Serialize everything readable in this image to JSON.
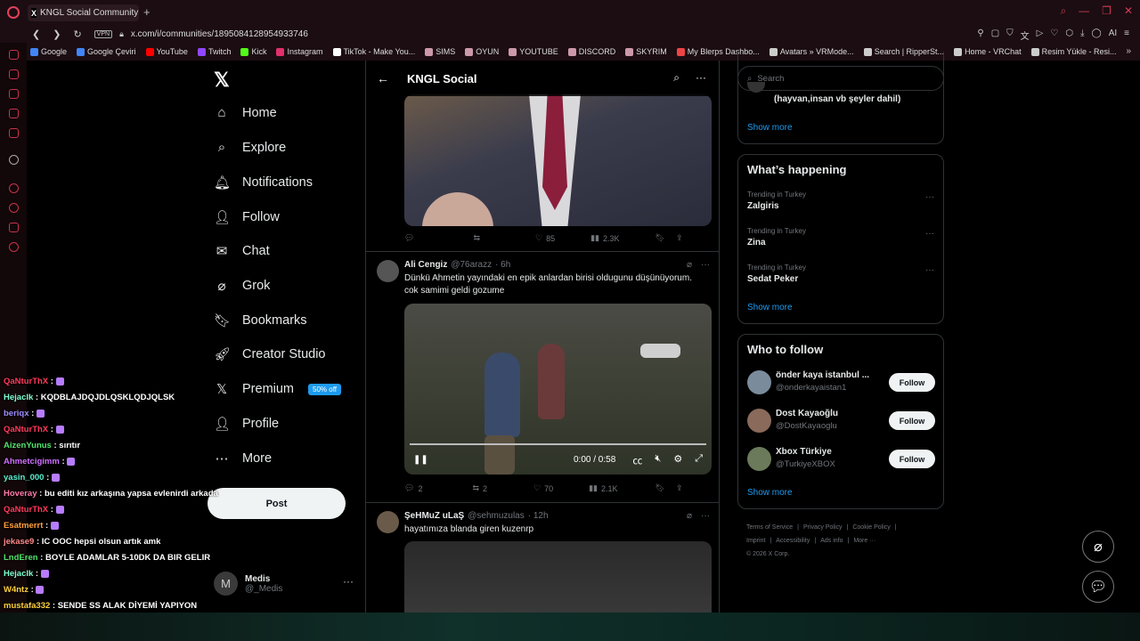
{
  "browser": {
    "tab_title": "KNGL Social Community /",
    "url": "x.com/i/communities/1895084128954933746",
    "vpn_label": "VPN",
    "bookmarks": [
      "Google",
      "Google Çeviri",
      "YouTube",
      "Twitch",
      "Kick",
      "Instagram",
      "TikTok - Make You...",
      "SIMS",
      "OYUN",
      "YOUTUBE",
      "DISCORD",
      "SKYRIM",
      "My Blerps Dashbo...",
      "Avatars » VRMode...",
      "Search | RipperSt...",
      "Home - VRChat",
      "Resim Yükle - Resi..."
    ],
    "bookmark_colors": [
      "#4285f4",
      "#4285f4",
      "#ff0000",
      "#9146ff",
      "#53fc18",
      "#e1306c",
      "#fff",
      "#c9a",
      "#c9a",
      "#c9a",
      "#c9a",
      "#c9a",
      "#e44",
      "#ccc",
      "#ccc",
      "#ccc",
      "#ccc"
    ],
    "ai_label": "AI"
  },
  "nav": {
    "items": [
      {
        "label": "Home",
        "icon": "home-icon",
        "glyph": "⌂"
      },
      {
        "label": "Explore",
        "icon": "search-icon",
        "glyph": "⌕"
      },
      {
        "label": "Notifications",
        "icon": "bell-icon",
        "glyph": "🔔︎"
      },
      {
        "label": "Follow",
        "icon": "person-add-icon",
        "glyph": "👤︎"
      },
      {
        "label": "Chat",
        "icon": "mail-icon",
        "glyph": "✉"
      },
      {
        "label": "Grok",
        "icon": "grok-icon",
        "glyph": "⌀"
      },
      {
        "label": "Bookmarks",
        "icon": "bookmark-icon",
        "glyph": "🔖︎"
      },
      {
        "label": "Creator Studio",
        "icon": "rocket-icon",
        "glyph": "🚀︎"
      },
      {
        "label": "Premium",
        "icon": "x-icon",
        "glyph": "𝕏"
      },
      {
        "label": "Profile",
        "icon": "profile-icon",
        "glyph": "👤︎"
      },
      {
        "label": "More",
        "icon": "more-circle-icon",
        "glyph": "⋯"
      }
    ],
    "premium_badge": "50% off",
    "post_label": "Post",
    "account": {
      "initial": "M",
      "name": "Medis",
      "handle": "@_Medis"
    }
  },
  "feed": {
    "title": "KNGL Social",
    "tweet1_actions": {
      "likes": "85",
      "views": "2.3K"
    },
    "tweet2": {
      "name": "Ali Cengiz",
      "handle": "@76arazz",
      "time": "· 6h",
      "text": "Dünkü Ahmetin yayındaki en epik anlardan birisi oldugunu düşünüyorum. cok samimi geldi gozume",
      "video_time": "0:00 / 0:58",
      "replies": "2",
      "reposts": "2",
      "likes": "70",
      "views": "2.1K"
    },
    "tweet3": {
      "name": "ŞeHMuZ uLaŞ",
      "handle": "@sehmuzulas",
      "time": "· 12h",
      "text": "hayatımıza blanda giren kuzenrp"
    }
  },
  "sidebar": {
    "search_placeholder": "Search",
    "top_panel_text": "(hayvan,insan vb şeyler dahil)",
    "show_more": "Show more",
    "happening_title": "What’s happening",
    "trends": [
      {
        "label": "Trending in Turkey",
        "name": "Zalgiris"
      },
      {
        "label": "Trending in Turkey",
        "name": "Zina"
      },
      {
        "label": "Trending in Turkey",
        "name": "Sedat Peker"
      }
    ],
    "wtf_title": "Who to follow",
    "who_to_follow": [
      {
        "name": "önder kaya istanbul ...",
        "handle": "@onderkayaistan1",
        "avatar_color": "#7a8b9c"
      },
      {
        "name": "Dost Kayaoğlu",
        "handle": "@DostKayaoglu",
        "avatar_color": "#8a6a5a"
      },
      {
        "name": "Xbox Türkiye",
        "handle": "@TurkiyeXBOX",
        "avatar_color": "#6a7a5a"
      }
    ],
    "follow_label": "Follow",
    "footer": [
      "Terms of Service",
      "|",
      "Privacy Policy",
      "|",
      "Cookie Policy",
      "|",
      "Imprint",
      "|",
      "Accessibility",
      "|",
      "Ads info",
      "|",
      "More ···",
      "© 2026 X Corp."
    ]
  },
  "stream_chat": [
    {
      "user": "QaNturThX",
      "color": "#ff3b5c",
      "msg": ""
    },
    {
      "user": "Hejaclk",
      "color": "#7fffd4",
      "msg": "KQDBLAJDQJDLQSKLQDJQLSK"
    },
    {
      "user": "beriqx",
      "color": "#9b8cff",
      "msg": ""
    },
    {
      "user": "QaNturThX",
      "color": "#ff3b5c",
      "msg": ""
    },
    {
      "user": "AizenYunus",
      "color": "#50e36b",
      "msg": "sırıtır"
    },
    {
      "user": "Ahmetcigimm",
      "color": "#d070ff",
      "msg": ""
    },
    {
      "user": "yasin_000",
      "color": "#59f0d0",
      "msg": ""
    },
    {
      "user": "Hoveray",
      "color": "#ff7aa8",
      "msg": "bu editi kız arkaşına yapsa evlenirdi arkada"
    },
    {
      "user": "QaNturThX",
      "color": "#ff3b5c",
      "msg": ""
    },
    {
      "user": "Esatmerrt",
      "color": "#ff9f3b",
      "msg": ""
    },
    {
      "user": "jekase9",
      "color": "#ff8a8a",
      "msg": "IC OOC hepsi olsun artık amk"
    },
    {
      "user": "LndEren",
      "color": "#50e36b",
      "msg": "BOYLE ADAMLAR 5-10DK DA BIR GELIR"
    },
    {
      "user": "Hejaclk",
      "color": "#7fffd4",
      "msg": ""
    },
    {
      "user": "W4ntz",
      "color": "#ffd23b",
      "msg": ""
    },
    {
      "user": "mustafa332",
      "color": "#ffd23b",
      "msg": "SENDE SS ALAK DİYEMİ YAPIYON"
    }
  ]
}
